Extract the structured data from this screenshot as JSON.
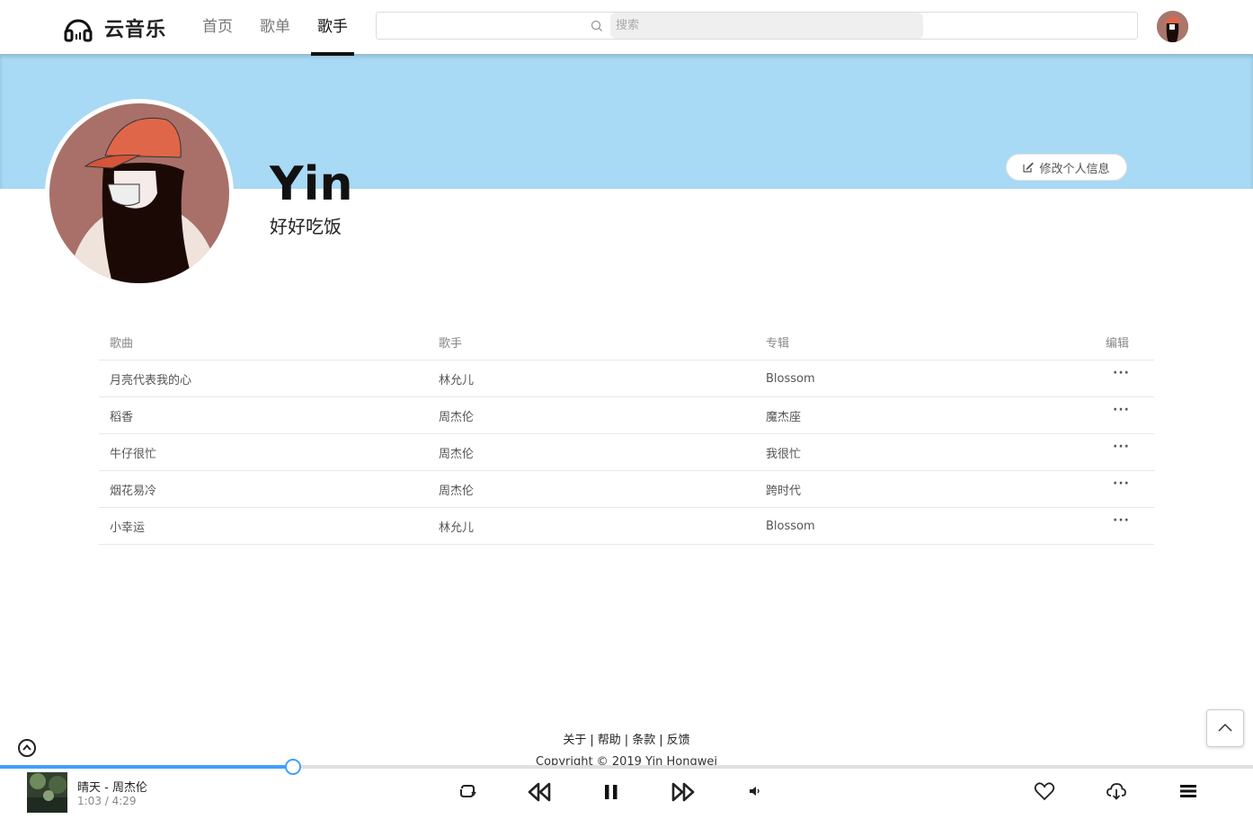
{
  "header": {
    "app_name": "云音乐",
    "nav": [
      "首页",
      "歌单",
      "歌手"
    ],
    "active_nav": "歌手",
    "search_placeholder": "搜索"
  },
  "profile": {
    "name": "Yin",
    "signature": "好好吃饭",
    "edit_label": "修改个人信息",
    "banner_color": "#a8d9f5"
  },
  "table": {
    "headers": {
      "song": "歌曲",
      "singer": "歌手",
      "album": "专辑",
      "edit": "编辑"
    },
    "more_label": "···",
    "rows": [
      {
        "song": "月亮代表我的心",
        "singer": "林允儿",
        "album": "Blossom"
      },
      {
        "song": "稻香",
        "singer": "周杰伦",
        "album": "魔杰座"
      },
      {
        "song": "牛仔很忙",
        "singer": "周杰伦",
        "album": "我很忙"
      },
      {
        "song": "烟花易冷",
        "singer": "周杰伦",
        "album": "跨时代"
      },
      {
        "song": "小幸运",
        "singer": "林允儿",
        "album": "Blossom"
      }
    ]
  },
  "footer": {
    "links": [
      "关于",
      "帮助",
      "条款",
      "反馈"
    ],
    "separator": "|",
    "copyright": "Copyright © 2019 Yin Hongwei"
  },
  "player": {
    "title": "晴天 - 周杰伦",
    "time": "1:03 / 4:29",
    "progress_fraction": 0.234,
    "accent": "#409eff"
  }
}
